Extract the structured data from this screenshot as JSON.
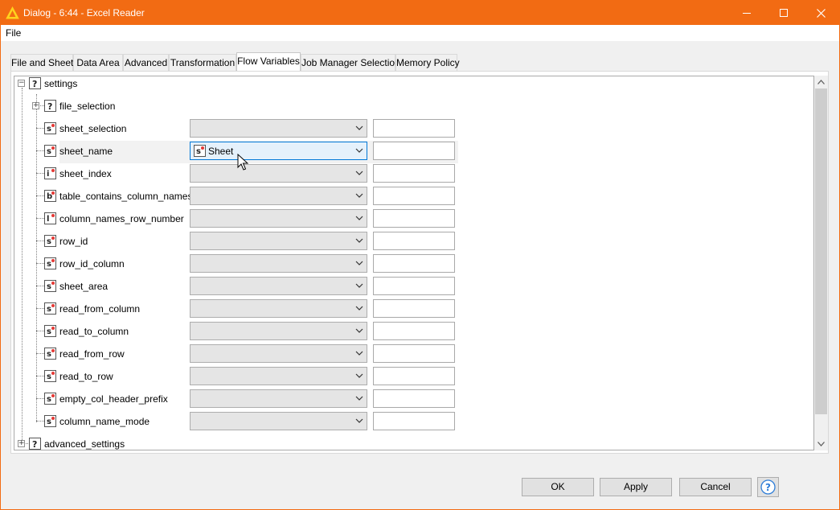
{
  "window": {
    "title": "Dialog - 6:44 - Excel Reader",
    "accent_color": "#f26b13",
    "controls": {
      "minimize": "minimize-icon",
      "maximize": "maximize-icon",
      "close": "close-icon"
    }
  },
  "menu": {
    "file": "File"
  },
  "tabs": [
    {
      "label": "File and Sheet",
      "active": false
    },
    {
      "label": "Data Area",
      "active": false
    },
    {
      "label": "Advanced",
      "active": false
    },
    {
      "label": "Transformation",
      "active": false
    },
    {
      "label": "Flow Variables",
      "active": true
    },
    {
      "label": "Job Manager Selection",
      "active": false
    },
    {
      "label": "Memory Policy",
      "active": false
    }
  ],
  "tree": {
    "root": {
      "label": "settings",
      "type_letter": "?"
    },
    "file_selection": {
      "label": "file_selection",
      "type_letter": "?"
    },
    "rows": [
      {
        "label": "sheet_selection",
        "type_letter": "s",
        "combo_value": ""
      },
      {
        "label": "sheet_name",
        "type_letter": "s",
        "combo_value": "Sheet",
        "combo_letter": "s"
      },
      {
        "label": "sheet_index",
        "type_letter": "i",
        "combo_value": ""
      },
      {
        "label": "table_contains_column_names",
        "type_letter": "b",
        "combo_value": ""
      },
      {
        "label": "column_names_row_number",
        "type_letter": "l",
        "combo_value": ""
      },
      {
        "label": "row_id",
        "type_letter": "s",
        "combo_value": ""
      },
      {
        "label": "row_id_column",
        "type_letter": "s",
        "combo_value": ""
      },
      {
        "label": "sheet_area",
        "type_letter": "s",
        "combo_value": ""
      },
      {
        "label": "read_from_column",
        "type_letter": "s",
        "combo_value": ""
      },
      {
        "label": "read_to_column",
        "type_letter": "s",
        "combo_value": ""
      },
      {
        "label": "read_from_row",
        "type_letter": "s",
        "combo_value": ""
      },
      {
        "label": "read_to_row",
        "type_letter": "s",
        "combo_value": ""
      },
      {
        "label": "empty_col_header_prefix",
        "type_letter": "s",
        "combo_value": ""
      },
      {
        "label": "column_name_mode",
        "type_letter": "s",
        "combo_value": ""
      }
    ],
    "advanced": {
      "label": "advanced_settings",
      "type_letter": "?"
    }
  },
  "buttons": {
    "ok": "OK",
    "apply": "Apply",
    "cancel": "Cancel",
    "help": "?"
  }
}
